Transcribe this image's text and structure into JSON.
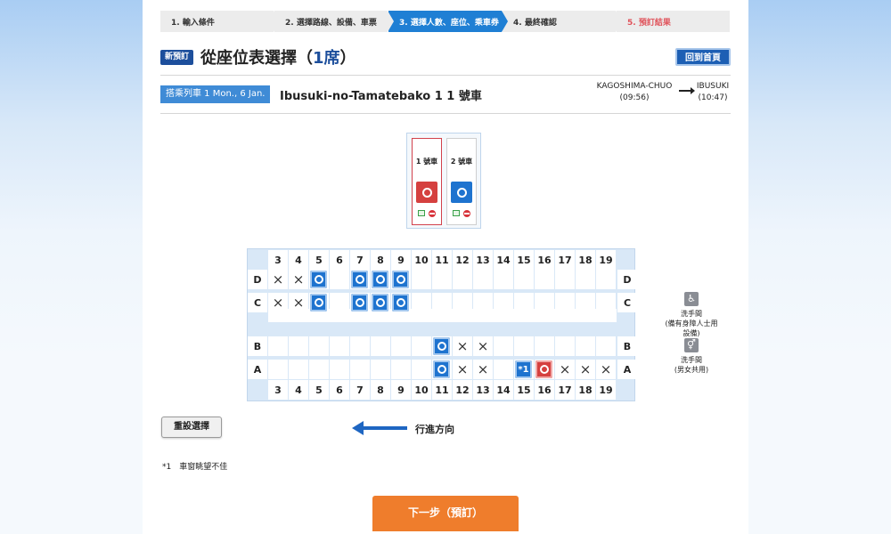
{
  "steps": [
    {
      "label": "1.  輸入條件"
    },
    {
      "label": "2.  選擇路線、設備、車票"
    },
    {
      "label": "3.  選擇人數、座位、乘車券"
    },
    {
      "label": "4.  最終確認"
    },
    {
      "label": "5.  預訂結果"
    }
  ],
  "header": {
    "badge": "新預訂",
    "title_prefix": "從座位表選擇（",
    "title_count": "1席",
    "title_suffix": "）",
    "home_button": "回到首頁"
  },
  "train": {
    "tag": "搭乘列車 1   Mon., 6 Jan.",
    "name": "Ibusuki-no-Tamatebako 1  1 號車",
    "from_station": "KAGOSHIMA-CHUO",
    "from_time": "(09:56)",
    "to_station": "IBUSUKI",
    "to_time": "(10:47)"
  },
  "cars": [
    {
      "label": "1 號車",
      "selected": true
    },
    {
      "label": "2 號車",
      "selected": false
    }
  ],
  "seat_map": {
    "columns": [
      "3",
      "4",
      "5",
      "6",
      "7",
      "8",
      "9",
      "10",
      "11",
      "12",
      "13",
      "14",
      "15",
      "16",
      "17",
      "18",
      "19"
    ],
    "rows": [
      "D",
      "C",
      "B",
      "A"
    ],
    "seat_note_label": "*1"
  },
  "facilities": [
    {
      "icon": "wheelchair-icon",
      "label_line1": "洗手間",
      "label_line2": "(備有身障人士用設備)"
    },
    {
      "icon": "restroom-icon",
      "label_line1": "洗手間",
      "label_line2": "(男女共用)"
    }
  ],
  "controls": {
    "reset_button": "重設選擇",
    "direction_label": "行進方向",
    "footnote_mark": "*1",
    "footnote_text": "車窗眺望不佳",
    "next_button": "下一步（預訂）"
  },
  "colors": {
    "accent": "#1f7fd4",
    "brand_dark": "#1d4f9c",
    "selected_seat": "#d5403f",
    "available_seat": "#1e73cf",
    "next_button": "#ef7d2c"
  }
}
